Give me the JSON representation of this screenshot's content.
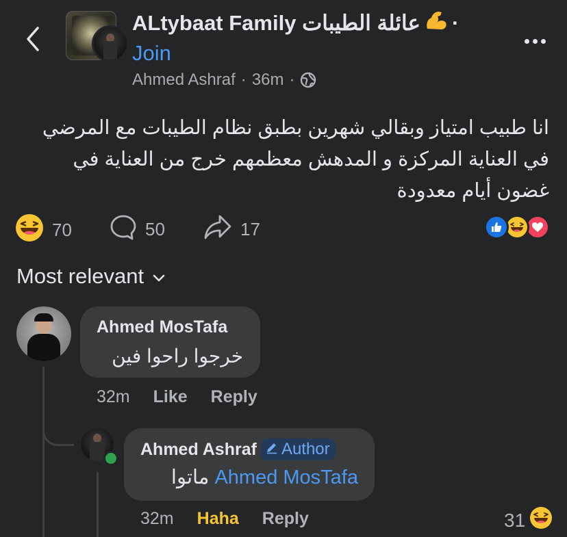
{
  "header": {
    "group_title": "ALtybaat Family عائلة الطيبات",
    "title_suffix": "·",
    "join_label": "Join",
    "author_name": "Ahmed Ashraf",
    "separator": "·",
    "time": "36m",
    "separator2": "·",
    "icons": {
      "back": "chevron-left-icon",
      "more": "more-icon",
      "privacy": "globe-icon",
      "muscle": "flexed-biceps-emoji"
    }
  },
  "post": {
    "text": "انا طبيب امتياز وبقالي شهرين بطبق نظام الطيبات مع المرضي في العناية المركزة و المدهش معظمهم خرج من العناية في غضون أيام معدودة"
  },
  "stats": {
    "reactions_count": "70",
    "comments_count": "50",
    "shares_count": "17",
    "reaction_types": [
      "like",
      "haha",
      "love"
    ]
  },
  "sort": {
    "label": "Most relevant"
  },
  "comments": [
    {
      "author": "Ahmed MosTafa",
      "text": "خرجوا راحوا فين",
      "time": "32m",
      "like_label": "Like",
      "reply_label": "Reply"
    }
  ],
  "reply": {
    "author": "Ahmed Ashraf",
    "badge": "Author",
    "text_prefix": "ماتوا",
    "mention": "Ahmed MosTafa",
    "time": "32m",
    "reaction_label": "Haha",
    "reply_label": "Reply",
    "reaction_count": "31"
  },
  "colors": {
    "background": "#242526",
    "bubble": "#3a3b3c",
    "accent_blue": "#4a9af5",
    "haha_yellow": "#f7c531",
    "love_red": "#f0425d",
    "like_blue": "#1b74e4",
    "online_green": "#31a24c"
  }
}
